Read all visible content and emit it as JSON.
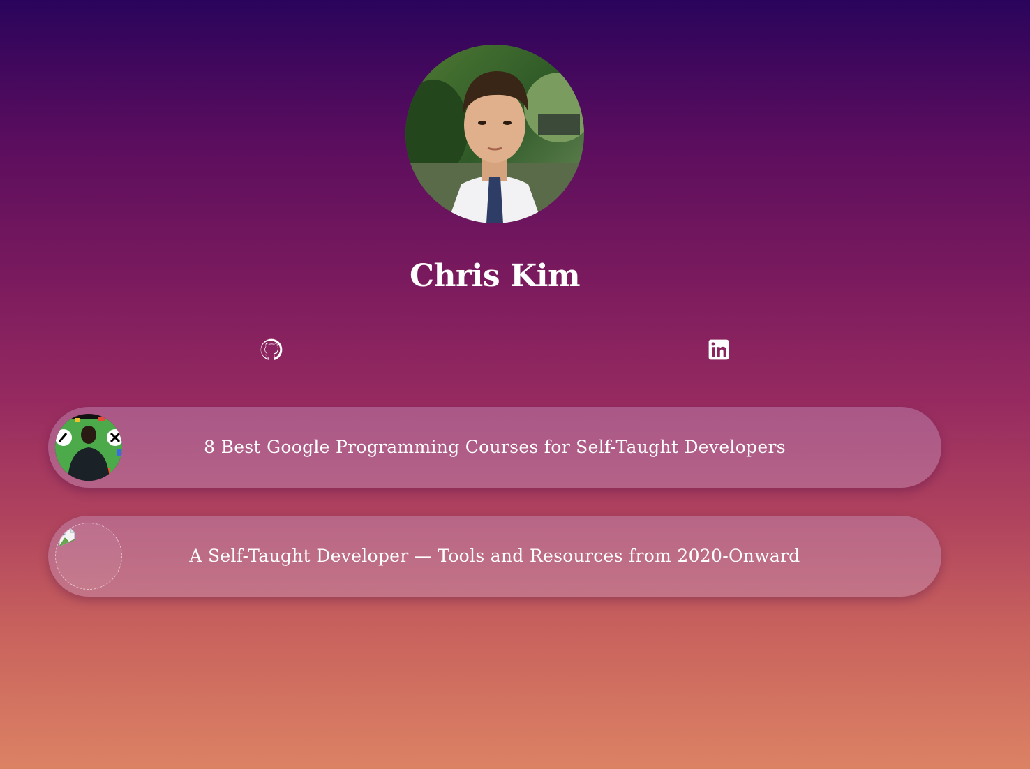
{
  "profile": {
    "name": "Chris Kim",
    "avatar_icon": "profile-photo"
  },
  "social": [
    {
      "icon": "github-icon"
    },
    {
      "icon": "linkedin-icon"
    }
  ],
  "links": [
    {
      "title": "8 Best Google Programming Courses for Self-Taught Developers",
      "thumbnail": "course-thumbnail"
    },
    {
      "title": "A Self-Taught Developer — Tools and Resources from 2020-Onward",
      "thumbnail": "broken-image-icon"
    }
  ],
  "colors": {
    "gradient_top": "#2a045c",
    "gradient_bottom": "#dc8264",
    "text": "#ffffff",
    "card_background": "rgba(200,160,200,0.38)"
  }
}
